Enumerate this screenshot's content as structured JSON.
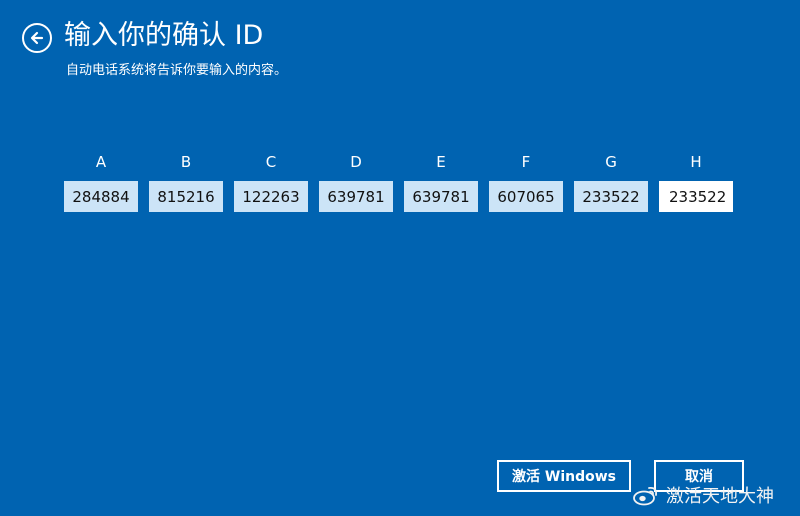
{
  "header": {
    "back_icon": "back-arrow-circle-icon",
    "title": "输入你的确认 ID",
    "subtitle": "自动电话系统将告诉你要输入的内容。"
  },
  "confirmation_fields": [
    {
      "label": "A",
      "value": "284884",
      "active": false
    },
    {
      "label": "B",
      "value": "815216",
      "active": false
    },
    {
      "label": "C",
      "value": "122263",
      "active": false
    },
    {
      "label": "D",
      "value": "639781",
      "active": false
    },
    {
      "label": "E",
      "value": "639781",
      "active": false
    },
    {
      "label": "F",
      "value": "607065",
      "active": false
    },
    {
      "label": "G",
      "value": "233522",
      "active": false
    },
    {
      "label": "H",
      "value": "233522",
      "active": true
    }
  ],
  "buttons": {
    "activate_label": "激活 Windows",
    "cancel_label": "取消"
  },
  "watermark": {
    "icon": "weibo-icon",
    "text": "激活天地大神"
  },
  "colors": {
    "background": "#0063b1",
    "field_fill": "#cce4f7",
    "active_field_fill": "#ffffff",
    "text": "#ffffff"
  }
}
